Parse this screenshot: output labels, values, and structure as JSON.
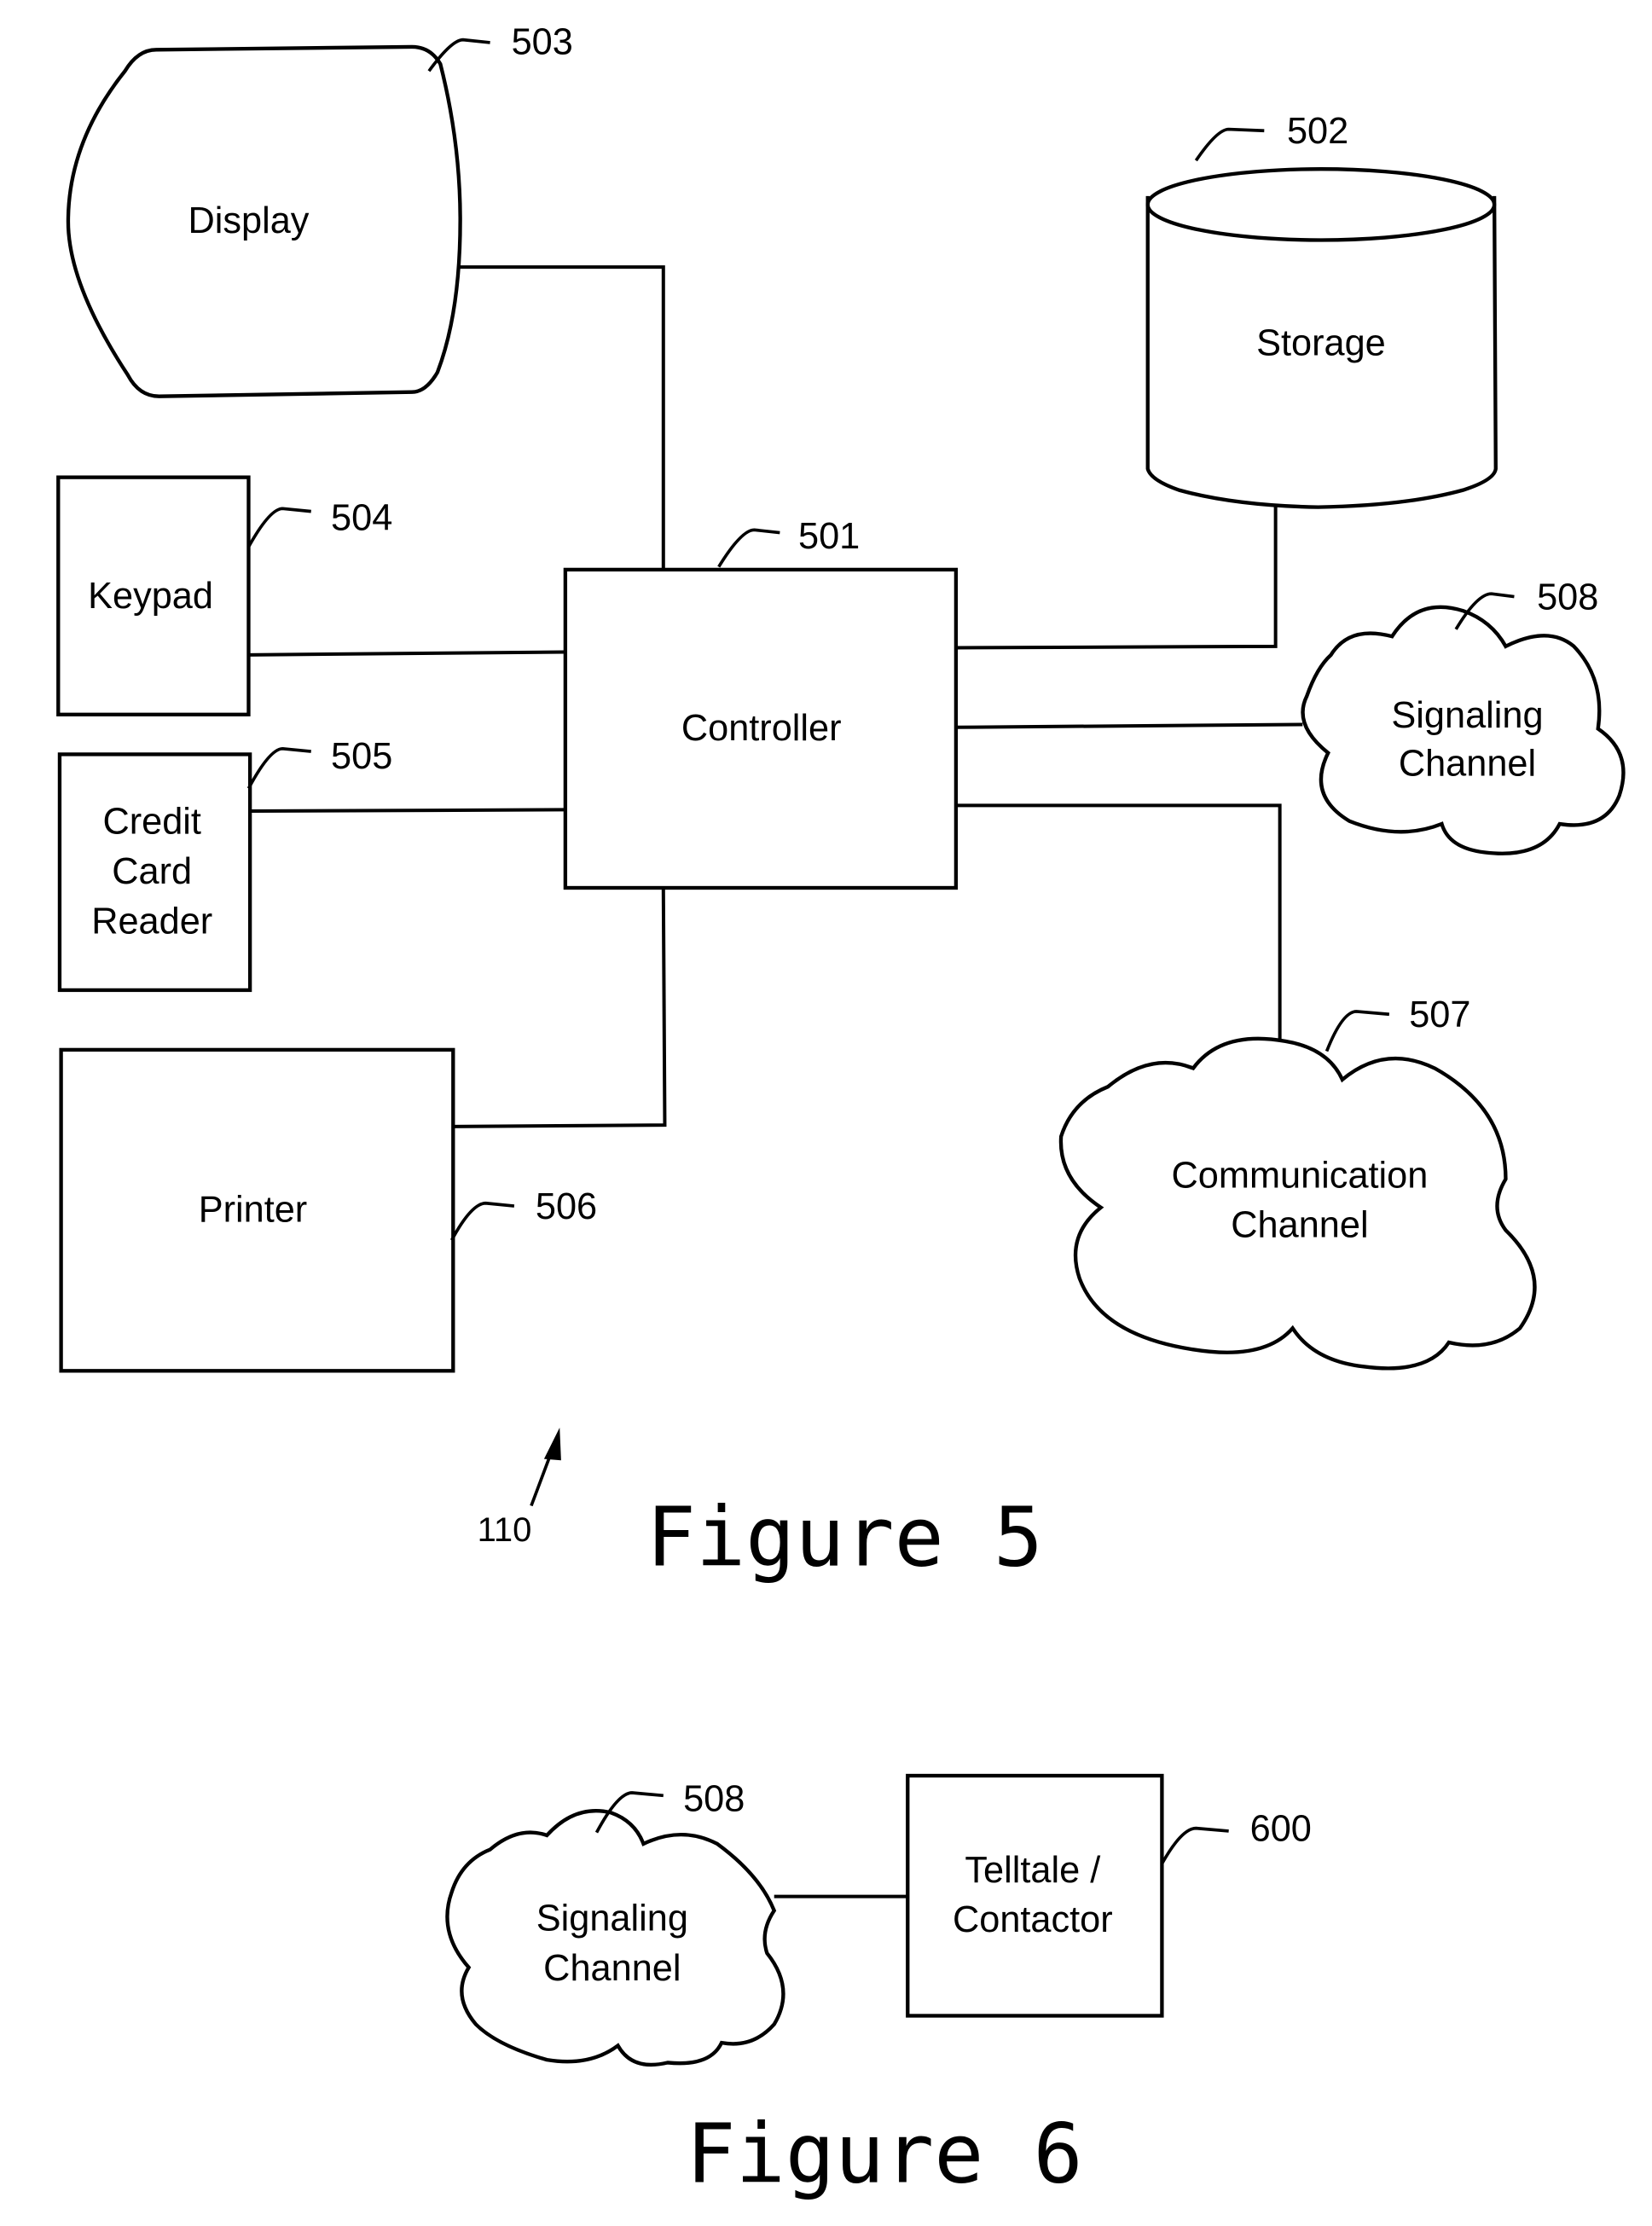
{
  "figures": [
    {
      "caption": "Figure 5",
      "assembly_ref": "110",
      "components": {
        "display": {
          "label": [
            "Display"
          ],
          "ref": "503"
        },
        "storage": {
          "label": [
            "Storage"
          ],
          "ref": "502"
        },
        "keypad": {
          "label": [
            "Keypad"
          ],
          "ref": "504"
        },
        "controller": {
          "label": [
            "Controller"
          ],
          "ref": "501"
        },
        "signaling_channel": {
          "label": [
            "Signaling",
            "Channel"
          ],
          "ref": "508"
        },
        "credit_card_reader": {
          "label": [
            "Credit",
            "Card",
            "Reader"
          ],
          "ref": "505"
        },
        "communication_channel": {
          "label": [
            "Communication",
            "Channel"
          ],
          "ref": "507"
        },
        "printer": {
          "label": [
            "Printer"
          ],
          "ref": "506"
        }
      },
      "connections": [
        [
          "display",
          "controller"
        ],
        [
          "keypad",
          "controller"
        ],
        [
          "credit_card_reader",
          "controller"
        ],
        [
          "printer",
          "controller"
        ],
        [
          "storage",
          "controller"
        ],
        [
          "signaling_channel",
          "controller"
        ],
        [
          "communication_channel",
          "controller"
        ]
      ]
    },
    {
      "caption": "Figure 6",
      "components": {
        "signaling_channel": {
          "label": [
            "Signaling",
            "Channel"
          ],
          "ref": "508"
        },
        "telltale_contactor": {
          "label": [
            "Telltale /",
            "Contactor"
          ],
          "ref": "600"
        }
      },
      "connections": [
        [
          "signaling_channel",
          "telltale_contactor"
        ]
      ]
    }
  ]
}
